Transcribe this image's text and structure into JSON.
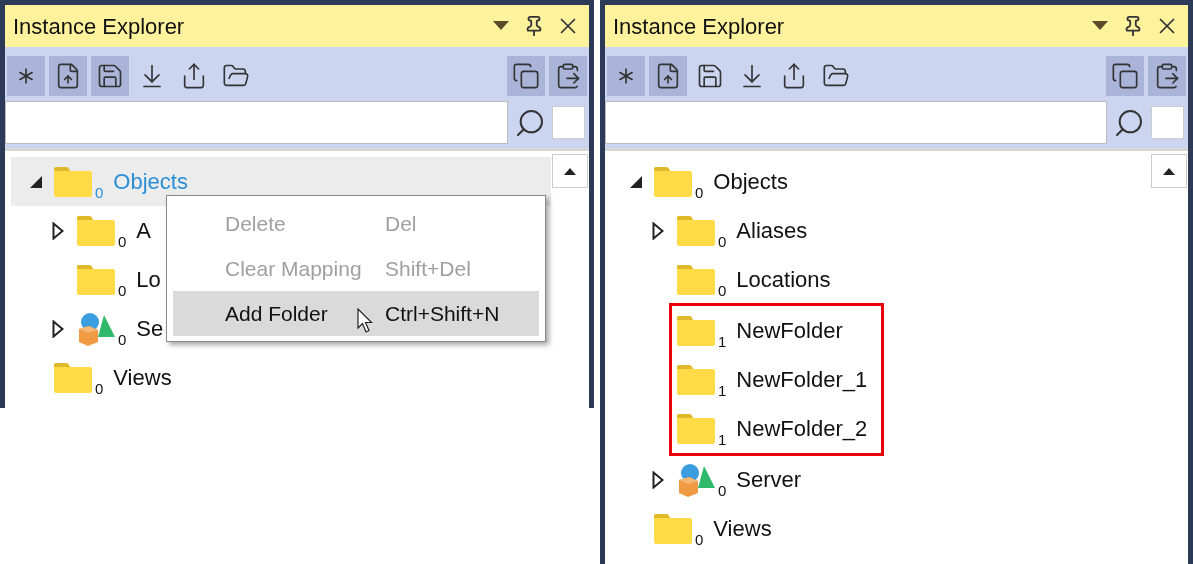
{
  "panels": [
    {
      "title": "Instance Explorer",
      "toolbar": [
        {
          "kind": "asterisk",
          "pressed": true
        },
        {
          "kind": "upload-file",
          "pressed": true
        },
        {
          "kind": "save",
          "pressed": true
        },
        {
          "kind": "download",
          "pressed": false
        },
        {
          "kind": "share",
          "pressed": false
        },
        {
          "kind": "open-folder",
          "pressed": false
        }
      ],
      "right_tools": [
        {
          "kind": "copy",
          "pressed": true
        },
        {
          "kind": "paste",
          "pressed": true
        }
      ],
      "tree": [
        {
          "label": "Objects",
          "count": "0",
          "kind": "folder",
          "expanded": true,
          "selected": true,
          "highlighted": false,
          "children": [
            {
              "label": "A",
              "count": "0",
              "kind": "folder",
              "expanded": false,
              "selected": false,
              "highlighted": false
            },
            {
              "label": "Lo",
              "count": "0",
              "kind": "folder",
              "selected": false,
              "highlighted": false
            },
            {
              "label": "Se",
              "count": "0",
              "kind": "shapes",
              "expanded": false,
              "selected": false,
              "highlighted": false
            }
          ]
        },
        {
          "label": "Views",
          "count": "0",
          "kind": "folder",
          "selected": false,
          "highlighted": false
        }
      ],
      "context_menu": {
        "items": [
          {
            "label": "Delete",
            "shortcut": "Del",
            "disabled": true,
            "selected": false
          },
          {
            "label": "Clear Mapping",
            "shortcut": "Shift+Del",
            "disabled": true,
            "selected": false
          },
          {
            "label": "Add Folder",
            "shortcut": "Ctrl+Shift+N",
            "disabled": false,
            "selected": true
          }
        ]
      }
    },
    {
      "title": "Instance Explorer",
      "toolbar": [
        {
          "kind": "asterisk",
          "pressed": true
        },
        {
          "kind": "upload-file",
          "pressed": true
        },
        {
          "kind": "save",
          "pressed": false
        },
        {
          "kind": "download",
          "pressed": false
        },
        {
          "kind": "share",
          "pressed": false
        },
        {
          "kind": "open-folder",
          "pressed": false
        }
      ],
      "right_tools": [
        {
          "kind": "copy",
          "pressed": true
        },
        {
          "kind": "paste",
          "pressed": true
        }
      ],
      "tree": [
        {
          "label": "Objects",
          "count": "0",
          "kind": "folder",
          "expanded": true,
          "selected": false,
          "highlighted": false,
          "children": [
            {
              "label": "Aliases",
              "count": "0",
              "kind": "folder",
              "expanded": false,
              "selected": false,
              "highlighted": false
            },
            {
              "label": "Locations",
              "count": "0",
              "kind": "folder",
              "selected": false,
              "highlighted": false
            },
            {
              "label": "NewFolder",
              "count": "1",
              "kind": "folder",
              "selected": false,
              "highlighted": true
            },
            {
              "label": "NewFolder_1",
              "count": "1",
              "kind": "folder",
              "selected": false,
              "highlighted": true
            },
            {
              "label": "NewFolder_2",
              "count": "1",
              "kind": "folder",
              "selected": false,
              "highlighted": true
            },
            {
              "label": "Server",
              "count": "0",
              "kind": "shapes",
              "expanded": false,
              "selected": false,
              "highlighted": false
            }
          ]
        },
        {
          "label": "Views",
          "count": "0",
          "kind": "folder",
          "selected": false,
          "highlighted": false
        }
      ]
    }
  ]
}
